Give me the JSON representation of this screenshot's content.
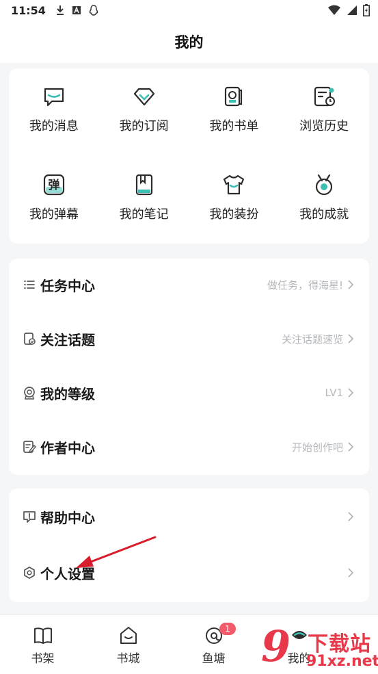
{
  "status": {
    "time": "11:54"
  },
  "header": {
    "title": "我的"
  },
  "grid": [
    {
      "label": "我的消息",
      "icon": "message-icon"
    },
    {
      "label": "我的订阅",
      "icon": "subscription-icon"
    },
    {
      "label": "我的书单",
      "icon": "booklist-icon"
    },
    {
      "label": "浏览历史",
      "icon": "history-icon"
    },
    {
      "label": "我的弹幕",
      "icon": "danmaku-icon",
      "glyph": "弹"
    },
    {
      "label": "我的笔记",
      "icon": "notes-icon"
    },
    {
      "label": "我的装扮",
      "icon": "outfit-icon"
    },
    {
      "label": "我的成就",
      "icon": "achievement-icon"
    }
  ],
  "list1": [
    {
      "title": "任务中心",
      "hint": "做任务，得海星!",
      "icon": "list-icon"
    },
    {
      "title": "关注话题",
      "hint": "关注话题速览",
      "icon": "topic-icon"
    },
    {
      "title": "我的等级",
      "hint": "LV1",
      "icon": "level-icon"
    },
    {
      "title": "作者中心",
      "hint": "开始创作吧",
      "icon": "author-icon"
    }
  ],
  "list2": [
    {
      "title": "帮助中心",
      "hint": "",
      "icon": "help-icon"
    },
    {
      "title": "个人设置",
      "hint": "",
      "icon": "settings-icon"
    }
  ],
  "tabs": [
    {
      "label": "书架",
      "icon": "bookshelf-icon"
    },
    {
      "label": "书城",
      "icon": "bookstore-icon"
    },
    {
      "label": "鱼塘",
      "icon": "fishpond-icon",
      "badge": "1"
    },
    {
      "label": "我的",
      "icon": "profile-icon"
    }
  ],
  "watermark": {
    "big": "9",
    "top": "下载站",
    "bottom": "91xz.net"
  },
  "colors": {
    "accent": "#3dbfb4",
    "stroke": "#2b2b2b",
    "badge": "#f25b6b",
    "watermark": "#e8394a"
  }
}
